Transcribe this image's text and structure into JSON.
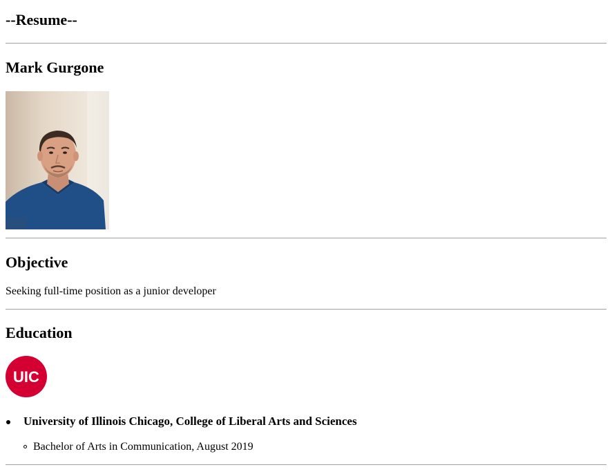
{
  "header": {
    "title": "--Resume--"
  },
  "profile": {
    "name": "Mark Gurgone",
    "photo_icon": "person-photo"
  },
  "objective": {
    "heading": "Objective",
    "text": "Seeking full-time position as a junior developer"
  },
  "education": {
    "heading": "Education",
    "logo": {
      "text": "UIC",
      "color": "#d50032"
    },
    "schools": [
      {
        "name": "University of Illinois Chicago, College of Liberal Arts and Sciences",
        "degrees": [
          "Bachelor of Arts in Communication, August 2019"
        ]
      }
    ]
  }
}
